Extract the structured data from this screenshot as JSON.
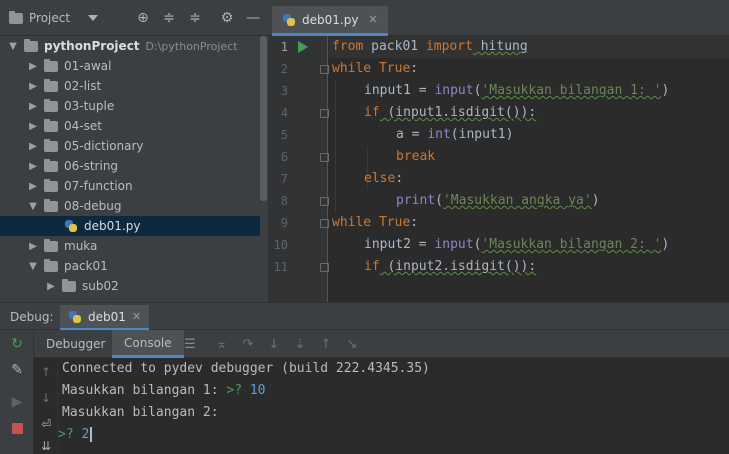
{
  "project_panel": {
    "title": "Project",
    "tree": [
      {
        "label": "pythonProject",
        "path": "D:\\pythonProject",
        "type": "project",
        "expanded": true
      },
      {
        "label": "01-awal",
        "type": "folder",
        "expanded": false
      },
      {
        "label": "02-list",
        "type": "folder",
        "expanded": false
      },
      {
        "label": "03-tuple",
        "type": "folder",
        "expanded": false
      },
      {
        "label": "04-set",
        "type": "folder",
        "expanded": false
      },
      {
        "label": "05-dictionary",
        "type": "folder",
        "expanded": false
      },
      {
        "label": "06-string",
        "type": "folder",
        "expanded": false
      },
      {
        "label": "07-function",
        "type": "folder",
        "expanded": false
      },
      {
        "label": "08-debug",
        "type": "folder",
        "expanded": true
      },
      {
        "label": "deb01.py",
        "type": "python-file",
        "selected": true
      },
      {
        "label": "muka",
        "type": "folder",
        "expanded": false
      },
      {
        "label": "pack01",
        "type": "package",
        "expanded": true
      },
      {
        "label": "sub02",
        "type": "package",
        "expanded": false
      }
    ]
  },
  "editor": {
    "tab_label": "deb01.py",
    "line_numbers": [
      "1",
      "2",
      "3",
      "4",
      "5",
      "6",
      "7",
      "8",
      "9",
      "10",
      "11"
    ],
    "current_line": "1",
    "code": {
      "l1": [
        "from",
        " pack01 ",
        "import",
        " hitung"
      ],
      "l2": [
        "while",
        " ",
        "True",
        ":"
      ],
      "l3": [
        "input1 = ",
        "input",
        "(",
        "'Masukkan bilangan 1: '",
        ")"
      ],
      "l4": [
        "if",
        " (input1.isdigit()):"
      ],
      "l5": [
        "a = ",
        "int",
        "(input1)"
      ],
      "l6": [
        "break"
      ],
      "l7": [
        "else",
        ":"
      ],
      "l8": [
        "print",
        "(",
        "'Masukkan angka ya'",
        ")"
      ],
      "l9": [
        "while",
        " ",
        "True",
        ":"
      ],
      "l10": [
        "input2 = ",
        "input",
        "(",
        "'Masukkan bilangan 2: '",
        ")"
      ],
      "l11": [
        "if",
        " (input2.isdigit()):"
      ]
    }
  },
  "debug_panel": {
    "label": "Debug:",
    "session_tab": "deb01",
    "tabs": [
      "Debugger",
      "Console"
    ],
    "active_tab": "Console",
    "console_lines": {
      "line1": "Connected to pydev debugger (build 222.4345.35)",
      "line2_text": "Masukkan bilangan 1: ",
      "line2_prompt": ">?",
      "line2_input": "10",
      "line3_text": "Masukkan bilangan 2:",
      "line4_prompt": ">?",
      "line4_input": "2"
    }
  },
  "colors": {
    "keyword": "#cc7832",
    "builtin": "#8888c6",
    "string": "#6a8759",
    "accent_tab": "#4a88c7",
    "selection": "#0d293e"
  }
}
